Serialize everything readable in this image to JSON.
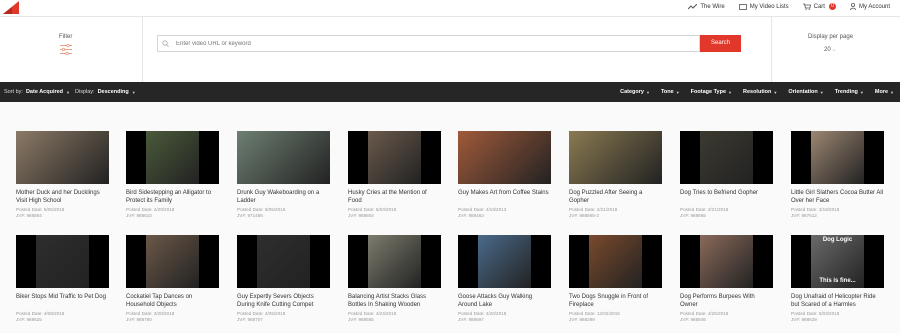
{
  "topnav": {
    "wire": "The Wire",
    "video_lists": "My Video Lists",
    "cart": "Cart",
    "cart_count": "0",
    "account": "My Account"
  },
  "search": {
    "filter_label": "Filter",
    "placeholder": "Enter video URL or keyword",
    "button": "Search",
    "display_per_page_label": "Display per page",
    "display_per_page_value": "20"
  },
  "sortbar": {
    "sort_label": "Sort by:",
    "sort_value": "Date Acquired",
    "display_label": "Display:",
    "display_value": "Descending",
    "filters": [
      "Category",
      "Tone",
      "Footage Type",
      "Resolution",
      "Orientation",
      "Trending",
      "More"
    ]
  },
  "videos": [
    {
      "title": "Mother Duck and her Ducklings Visit High School",
      "posted": "Posted Date: 5/05/2018",
      "jv": "JV#: 988864",
      "thumb": "#8c7a66"
    },
    {
      "title": "Bird Sidestepping an Alligator to Protect its Family",
      "posted": "Posted Date: 4/29/2018",
      "jv": "JV#: 988810",
      "thumb": "#4a5a3a"
    },
    {
      "title": "Drunk Guy Wakeboarding on a Ladder",
      "posted": "Posted Date: 8/05/2016",
      "jv": "JV#: 971486",
      "thumb": "#6e7f72"
    },
    {
      "title": "Husky Cries at the Mention of Food",
      "posted": "Posted Date: 5/03/2018",
      "jv": "JV#: 988804",
      "thumb": "#6a5a4c"
    },
    {
      "title": "Guy Makes Art from Coffee Stains",
      "posted": "Posted Date: 4/19/2013",
      "jv": "JV#: 988463",
      "thumb": "#a05a3a"
    },
    {
      "title": "Dog Puzzled After Seeing a Gopher",
      "posted": "Posted Date: 2/21/2018",
      "jv": "JV#: 988865-2",
      "thumb": "#8a7a52"
    },
    {
      "title": "Dog Tries to Befriend Gopher",
      "posted": "Posted Date: 2/21/2018",
      "jv": "JV#: 988865",
      "thumb": "#3c3a30"
    },
    {
      "title": "Little Girl Slathers Cocoa Butter All Over her Face",
      "posted": "Posted Date: 3/18/2018",
      "jv": "JV#: 987612",
      "thumb": "#9c8672"
    },
    {
      "title": "Biker Stops Mid Traffic to Pet Dog",
      "posted": "Posted Date: 4/08/2018",
      "jv": "JV#: 988625",
      "thumb": "#2e2e2e"
    },
    {
      "title": "Cockatiel Tap Dances on Household Objects",
      "posted": "Posted Date: 3/28/2018",
      "jv": "JV#: 988780",
      "thumb": "#6b5848"
    },
    {
      "title": "Guy Expertly Severs Objects During Knife Cutting Compet",
      "posted": "Posted Date: 4/09/2018",
      "jv": "JV#: 988707",
      "thumb": "#2e2e2e"
    },
    {
      "title": "Balancing Artist Stacks Glass Bottles In Shaking Wooden",
      "posted": "Posted Date: 4/24/2018",
      "jv": "JV#: 988565",
      "thumb": "#7c7c6e"
    },
    {
      "title": "Goose Attacks Guy Walking Around Lake",
      "posted": "Posted Date: 4/20/2018",
      "jv": "JV#: 988697",
      "thumb": "#4a6a8a"
    },
    {
      "title": "Two Dogs Snuggle in Front of Fireplace",
      "posted": "Posted Date: 12/02/2015",
      "jv": "JV#: 988399",
      "thumb": "#7a4a2c"
    },
    {
      "title": "Dog Performs Burpees With Owner",
      "posted": "Posted Date: 4/25/2018",
      "jv": "JV#: 988846",
      "thumb": "#8a6a5a"
    },
    {
      "title": "Dog Unafraid of Helicopter Ride but Scared of a Harmles",
      "posted": "Posted Date: 5/03/2018",
      "jv": "JV#: 988629",
      "thumb": "#6a6a6a"
    }
  ],
  "overlay_text": {
    "dog_logic": "Dog Logic",
    "this_is_fine": "This is fine..."
  },
  "colors": {
    "accent": "#e2372b",
    "sortbar_bg": "#262626"
  }
}
